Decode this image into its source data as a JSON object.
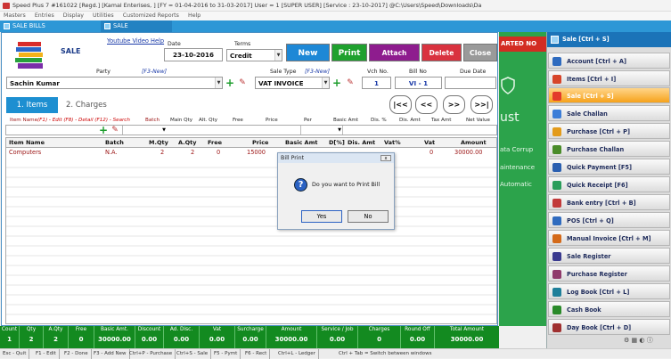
{
  "title_bar": "Speed Plus 7 #161022  [Regd.]  [Kamal Enterises, ] [FY = 01-04-2016 to 31-03-2017] User = 1 [SUPER USER]  [Service : 23-10-2017]  @C:\\Users\\Speed\\Downloads\\Da",
  "menu": [
    "Masters",
    "Entries",
    "Display",
    "Utilities",
    "Customized Reports",
    "Help"
  ],
  "tabs": [
    "SALE BILLS",
    "SALE"
  ],
  "form": {
    "heading": "SALE",
    "youtube_link": "Youtube Video Help",
    "date_label": "Date",
    "date": "23-10-2016",
    "terms_label": "Terms",
    "terms": "Credit",
    "party_label": "Party",
    "party_hint": "[F3-New]",
    "party": "Sachin Kumar",
    "sale_type_label": "Sale Type",
    "sale_type_hint": "[F3-New]",
    "sale_type": "VAT INVOICE",
    "vch_no_label": "Vch No.",
    "vch_no": "1",
    "bill_no_label": "Bill No",
    "bill_no": "VI - 1",
    "due_date_label": "Due Date",
    "due_date": ""
  },
  "buttons": {
    "new": "New",
    "print": "Print",
    "attach": "Attach",
    "delete": "Delete",
    "close": "Close"
  },
  "button_colors": {
    "new": "#1e88d6",
    "print": "#1fa12e",
    "attach": "#8e1c8e",
    "delete": "#d9323f",
    "close": "#9a9a9a"
  },
  "subtabs": {
    "items": "1. Items",
    "charges": "2. Charges"
  },
  "nav": [
    "|<<",
    "<<",
    ">>",
    ">>|"
  ],
  "entry_header": {
    "item_name": "Item Name",
    "item_hint": "(F1) - Edit  (F8) - Detail  (F12) - Search",
    "cols": [
      "Batch",
      "Main Qty",
      "Alt. Qty",
      "Free",
      "Price",
      "Per",
      "Basic Amt",
      "Dis. %",
      "Dis. Amt",
      "Tax Amt",
      "Net Value"
    ]
  },
  "grid": {
    "headers": [
      "Item Name",
      "Batch",
      "M.Qty",
      "A.Qty",
      "Free",
      "Price",
      "Basic Amt",
      "D[%]",
      "Dis. Amt",
      "Vat%",
      "Vat",
      "Amount"
    ],
    "rows": [
      {
        "item": "Computers",
        "batch": "N.A.",
        "mqty": "2",
        "aqty": "2",
        "free": "0",
        "price": "15000",
        "vat": "0",
        "amount": "30000.00"
      }
    ]
  },
  "dialog": {
    "title": "Bill Print",
    "close": "x",
    "message": "Do you want to Print Bill",
    "yes": "Yes",
    "no": "No"
  },
  "totals": [
    {
      "label": "Count",
      "value": "1"
    },
    {
      "label": "Qty",
      "value": "2"
    },
    {
      "label": "A.Qty",
      "value": "2"
    },
    {
      "label": "Free",
      "value": "0"
    },
    {
      "label": "Basic Amt.",
      "value": "30000.00"
    },
    {
      "label": "Discount",
      "value": "0.00"
    },
    {
      "label": "Ad. Disc.",
      "value": "0.00"
    },
    {
      "label": "Vat",
      "value": "0.00"
    },
    {
      "label": "Surcharge",
      "value": "0.00"
    },
    {
      "label": "Amount",
      "value": "30000.00"
    },
    {
      "label": "Service / Job",
      "value": "0.00"
    },
    {
      "label": "Charges",
      "value": "0"
    },
    {
      "label": "Round Off",
      "value": "0.00"
    },
    {
      "label": "Total Amount",
      "value": "30000.00"
    }
  ],
  "status_bar": [
    "Esc - Quit",
    "F1 - Edit",
    "F2 - Done",
    "F3 - Add New",
    "Ctrl+P - Purchase",
    "Ctrl+S - Sale",
    "F5 - Pymt",
    "F6 - Rect",
    "Ctrl+L - Ledger",
    "Ctrl + Tab = Switch between windows"
  ],
  "background_window": {
    "banner": "ARTED NO",
    "lines": [
      "ust",
      "ata Corrup",
      "aintenance",
      "Automatic"
    ]
  },
  "right_panel": {
    "header": "Sale [Ctrl + S]",
    "items": [
      {
        "label": "Account [Ctrl + A]",
        "icon_color": "#2f6bbf"
      },
      {
        "label": "Items [Ctrl + I]",
        "icon_color": "#d7452a"
      },
      {
        "label": "Sale [Ctrl + S]",
        "icon_color": "#e33b2b",
        "active": true
      },
      {
        "label": "Sale Challan",
        "icon_color": "#3b7dd8"
      },
      {
        "label": "Purchase [Ctrl + P]",
        "icon_color": "#e39b1b"
      },
      {
        "label": "Purchase Challan",
        "icon_color": "#4a8c2a"
      },
      {
        "label": "Quick Payment [F5]",
        "icon_color": "#2a5fb0"
      },
      {
        "label": "Quick Receipt [F6]",
        "icon_color": "#2a9d5a"
      },
      {
        "label": "Bank entry [Ctrl + B]",
        "icon_color": "#c23a3a"
      },
      {
        "label": "POS [Ctrl + Q]",
        "icon_color": "#2f6bbf"
      },
      {
        "label": "Manual Invoice [Ctrl + M]",
        "icon_color": "#d46a1a"
      },
      {
        "label": "Sale Register",
        "icon_color": "#3a3a8f"
      },
      {
        "label": "Purchase Register",
        "icon_color": "#8f3a6b"
      },
      {
        "label": "Log Book [Ctrl + L]",
        "icon_color": "#1f7f9a"
      },
      {
        "label": "Cash Book",
        "icon_color": "#2a8a2a"
      },
      {
        "label": "Day Book [Ctrl + D]",
        "icon_color": "#a03030"
      }
    ]
  }
}
